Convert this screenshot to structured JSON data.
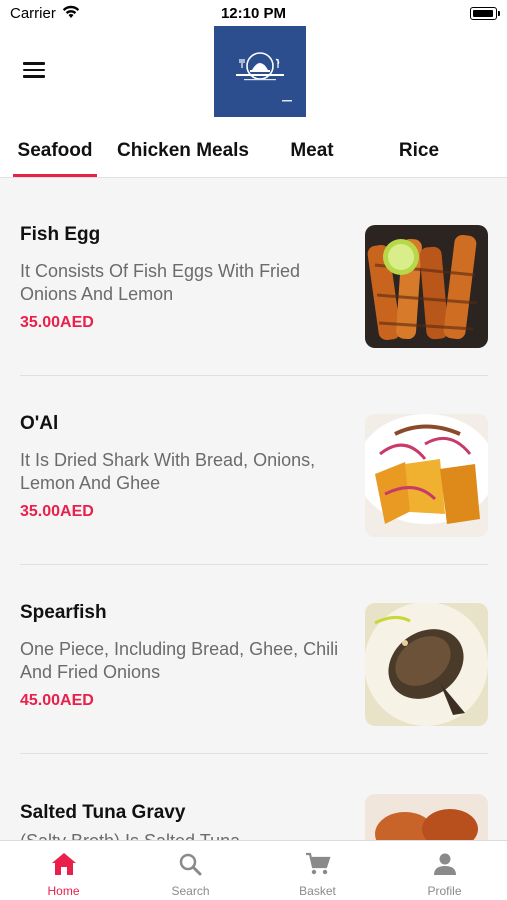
{
  "status_bar": {
    "carrier": "Carrier",
    "time": "12:10 PM"
  },
  "header": {
    "logo_icon": "restaurant-logo-icon",
    "menu_icon": "hamburger-menu-icon"
  },
  "tabs": [
    {
      "label": "Seafood",
      "active": true
    },
    {
      "label": "Chicken Meals",
      "active": false
    },
    {
      "label": "Meat",
      "active": false
    },
    {
      "label": "Rice",
      "active": false
    }
  ],
  "items": [
    {
      "name": "Fish Egg",
      "description": "It Consists Of Fish Eggs With Fried Onions And Lemon",
      "price": "35.00AED",
      "image": "fish-egg-photo"
    },
    {
      "name": "O'Al",
      "description": "It Is Dried Shark With Bread, Onions, Lemon And Ghee",
      "price": "35.00AED",
      "image": "oal-photo"
    },
    {
      "name": "Spearfish",
      "description": "One Piece, Including Bread, Ghee, Chili And Fried Onions",
      "price": "45.00AED",
      "image": "spearfish-photo"
    },
    {
      "name": "Salted Tuna Gravy",
      "description": "(Salty Broth) Is Salted Tuna",
      "price": "",
      "image": "salted-tuna-photo"
    }
  ],
  "bottom_nav": [
    {
      "label": "Home",
      "icon": "home-icon",
      "active": true
    },
    {
      "label": "Search",
      "icon": "search-icon",
      "active": false
    },
    {
      "label": "Basket",
      "icon": "cart-icon",
      "active": false
    },
    {
      "label": "Profile",
      "icon": "profile-icon",
      "active": false
    }
  ],
  "colors": {
    "accent": "#e8204a",
    "logo_bg": "#2d4e8e",
    "text_secondary": "#6b6b6b"
  }
}
